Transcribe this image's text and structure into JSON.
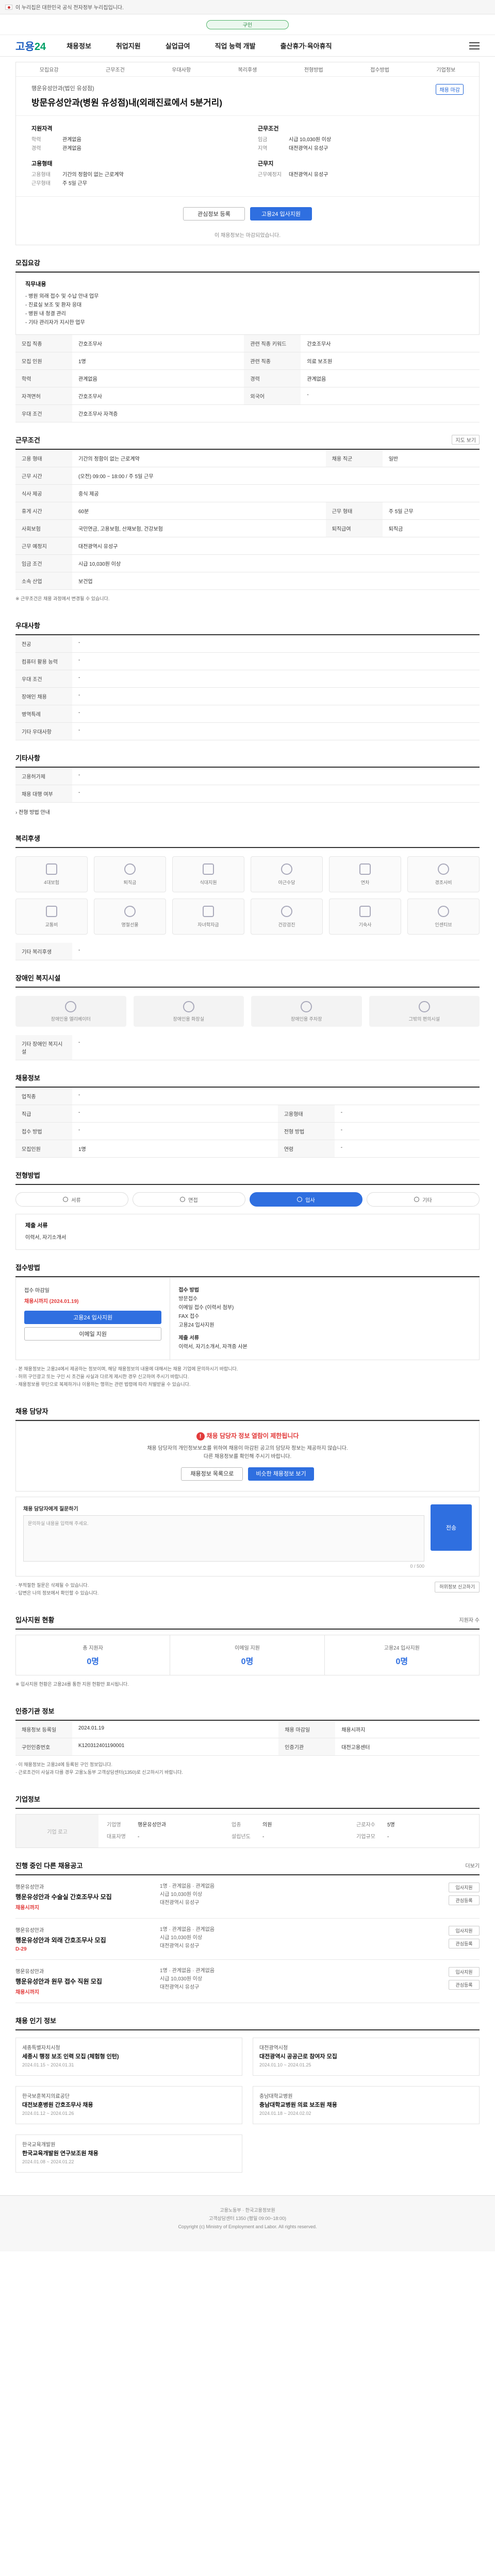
{
  "gov_banner": "이 누리집은 대한민국 공식 전자정부 누리집입니다.",
  "search": {
    "label": "구인"
  },
  "header": {
    "logo_main": "고용",
    "logo_sub": "24",
    "nav": [
      "채용정보",
      "취업지원",
      "실업급여",
      "직업 능력 개발",
      "출산휴가·육아휴직"
    ]
  },
  "title_tabs": [
    "모집요강",
    "근무조건",
    "우대사항",
    "복리후생",
    "전형방법",
    "접수방법",
    "기업정보"
  ],
  "posting": {
    "company": "행운유성안과(법인 유성점)",
    "title": "방문유성안과(병원 유성점)내(외래진료에서 5분거리)",
    "status": "채용 마감",
    "summary_left_title": "지원자격",
    "summary_left": [
      {
        "k": "학력",
        "v": "관계없음"
      },
      {
        "k": "경력",
        "v": "관계없음"
      }
    ],
    "summary_left2_title": "고용형태",
    "summary_left2": [
      {
        "k": "고용형태",
        "v": "기간의 정함이 없는 근로계약"
      },
      {
        "k": "근무형태",
        "v": "주 5일 근무"
      }
    ],
    "summary_right_title": "근무조건",
    "summary_right": [
      {
        "k": "임금",
        "v": "시급 10,030원 이상"
      },
      {
        "k": "지역",
        "v": "대전광역시 유성구"
      }
    ],
    "summary_right2_title": "근무지",
    "summary_right2": [
      {
        "k": "근무예정지",
        "v": "대전광역시 유성구"
      }
    ],
    "btn_scrap": "관심정보 등록",
    "btn_apply": "고용24 입사지원",
    "cta_note": "이 채용정보는 마감되었습니다."
  },
  "recruit": {
    "title": "모집요강",
    "job_desc_title": "직무내용",
    "job_desc": [
      "- 병원 외래 접수 및 수납 안내 업무",
      "- 진료실 보조 및 환자 응대",
      "- 병원 내 청결 관리",
      "- 기타 관리자가 지시한 업무"
    ],
    "rows": [
      {
        "th": "모집 직종",
        "td": "간호조무사",
        "th2": "관련 직종 키워드",
        "td2": "간호조무사"
      },
      {
        "th": "모집 인원",
        "td": "1명",
        "th2": "관련 직종",
        "td2": "의료 보조원"
      },
      {
        "th": "학력",
        "td": "관계없음",
        "th2": "경력",
        "td2": "관계없음"
      },
      {
        "th": "자격면허",
        "td": "간호조무사",
        "th2": "외국어",
        "td2": "-"
      },
      {
        "th": "우대 조건",
        "td": "간호조무사 자격증",
        "th2": "",
        "td2": ""
      }
    ]
  },
  "conditions": {
    "title": "근무조건",
    "rows": [
      {
        "th": "고용 형태",
        "td": "기간의 정함이 없는 근로계약",
        "th2": "채용 직군",
        "td2": "일반"
      },
      {
        "th": "근무 시간",
        "td": "(오전) 09:00 ~ 18:00 / 주 5일 근무",
        "th2": "",
        "td2": ""
      },
      {
        "th": "식사 제공",
        "td": "중식 제공",
        "th2": "",
        "td2": ""
      },
      {
        "th": "휴게 시간",
        "td": "60분",
        "th2": "근무 형태",
        "td2": "주 5일 근무"
      },
      {
        "th": "사회보험",
        "td": "국민연금, 고용보험, 산재보험, 건강보험",
        "th2": "퇴직급여",
        "td2": "퇴직금"
      },
      {
        "th": "근무 예정지",
        "td": "대전광역시 유성구",
        "th2": "",
        "td2": ""
      },
      {
        "th": "임금 조건",
        "td": "시급 10,030원 이상",
        "th2": "",
        "td2": ""
      },
      {
        "th": "소속 산업",
        "td": "보건업",
        "th2": "",
        "td2": ""
      }
    ],
    "map_btn": "지도 보기",
    "note": "※ 근무조건은 채용 과정에서 변경될 수 있습니다."
  },
  "pref": {
    "title": "우대사항",
    "rows": [
      {
        "th": "전공",
        "td": "-"
      },
      {
        "th": "컴퓨터 활용 능력",
        "td": "-"
      },
      {
        "th": "우대 조건",
        "td": "-"
      },
      {
        "th": "장애인 채용",
        "td": "-"
      },
      {
        "th": "병역특례",
        "td": "-"
      },
      {
        "th": "기타 우대사항",
        "td": "-"
      }
    ]
  },
  "etc": {
    "title": "기타사항",
    "rows": [
      {
        "th": "고용허가제",
        "td": "-"
      },
      {
        "th": "채용 대행 여부",
        "td": "-"
      }
    ],
    "link": "전형 방법 안내"
  },
  "benefits": {
    "title": "복리후생",
    "icons": [
      "4대보험",
      "퇴직금",
      "식대지원",
      "야근수당",
      "연차",
      "경조사비",
      "교통비",
      "명절선물",
      "자녀학자금",
      "건강검진",
      "기숙사",
      "인센티브"
    ],
    "other_label": "기타 복리후생"
  },
  "welfare": {
    "title": "장애인 복지시설",
    "items": [
      "장애인용 엘리베이터",
      "장애인용 화장실",
      "장애인용 주차장",
      "그밖의 편의시설"
    ],
    "other_label": "기타 장애인 복지시설"
  },
  "worker": {
    "title": "채용정보",
    "rows": [
      {
        "th": "업직종",
        "td": "-",
        "th2": "",
        "td2": ""
      },
      {
        "th": "직급",
        "td": "-",
        "th2": "고용형태",
        "td2": "-"
      },
      {
        "th": "접수 방법",
        "td": "-",
        "th2": "전형 방법",
        "td2": "-"
      },
      {
        "th": "모집인원",
        "td": "1명",
        "th2": "연령",
        "td2": "-"
      }
    ]
  },
  "process": {
    "title": "전형방법",
    "steps": [
      "서류",
      "면접",
      "입사",
      "기타"
    ],
    "active": 2,
    "sub_title": "제출 서류",
    "sub_text": "이력서, 자기소개서"
  },
  "apply": {
    "title": "접수방법",
    "period_label": "접수 마감일",
    "period": "채용시까지 (2024.01.19)",
    "btn_apply": "고용24 입사지원",
    "btn_email": "이메일 지원",
    "right_title": "접수 방법",
    "right_lines": [
      "방문접수",
      "이메일 접수 (이력서 첨부)",
      "FAX 접수",
      "고용24 입사지원"
    ],
    "right_title2": "제출 서류",
    "right_lines2": [
      "이력서, 자기소개서, 자격증 사본"
    ],
    "notices": [
      "· 본 채용정보는 고용24에서 제공하는 정보이며, 해당 채용정보의 내용에 대해서는 채용 기업에 문의하시기 바랍니다.",
      "· 허위 구인광고 또는 구인 시 조건을 사실과 다르게 제시한 경우 신고하여 주시기 바랍니다.",
      "· 채용정보를 무단으로 복제하거나 이용하는 행위는 관련 법령에 따라 처벌받을 수 있습니다."
    ]
  },
  "manager": {
    "title": "채용 담당자",
    "alert_title": "채용 담당자 정보 열람이 제한됩니다",
    "alert_lines": [
      "채용 담당자의 개인정보보호를 위하여 채용이 마감된 공고의 담당자 정보는 제공하지 않습니다.",
      "다른 채용정보를 확인해 주시기 바랍니다."
    ],
    "btn1": "채용정보 목록으로",
    "btn2": "비슷한 채용정보 보기",
    "qa_title": "채용 담당자에게 질문하기",
    "qa_placeholder": "문의하실 내용을 입력해 주세요.",
    "qa_count": "0 / 500",
    "qa_send": "전송",
    "qa_notes": [
      "· 부적절한 질문은 삭제될 수 있습니다.",
      "· 답변은 나의 정보에서 확인할 수 있습니다."
    ],
    "report_btn": "허위정보 신고하기"
  },
  "stats": {
    "title": "입사지원 현황",
    "right": "지원자 수",
    "items": [
      {
        "label": "총 지원자",
        "value": "0명"
      },
      {
        "label": "이메일 지원",
        "value": "0명"
      },
      {
        "label": "고용24 입사지원",
        "value": "0명"
      }
    ],
    "note": "※ 입사지원 현황은 고용24를 통한 지원 현황만 표시됩니다."
  },
  "regist": {
    "title": "인증기관 정보",
    "rows": [
      {
        "th": "채용정보 등록일",
        "td": "2024.01.19",
        "th2": "채용 마감일",
        "td2": "채용시까지"
      },
      {
        "th": "구인인증번호",
        "td": "K120312401190001",
        "th2": "인증기관",
        "td2": "대전고용센터"
      }
    ],
    "notes": [
      "· 이 채용정보는 고용24에 등록된 구인 정보입니다.",
      "· 근로조건이 사실과 다를 경우 고용노동부 고객상담센터(1350)로 신고하시기 바랍니다."
    ]
  },
  "company": {
    "title": "기업정보",
    "logo_text": "기업 로고",
    "fields": [
      {
        "k": "기업명",
        "v": "행운유성안과"
      },
      {
        "k": "업종",
        "v": "의원"
      },
      {
        "k": "근로자수",
        "v": "5명"
      },
      {
        "k": "대표자명",
        "v": "-"
      },
      {
        "k": "설립년도",
        "v": "-"
      },
      {
        "k": "기업규모",
        "v": "-"
      }
    ]
  },
  "same_company": {
    "title": "진행 중인 다른 채용공고",
    "right": "더보기",
    "jobs": [
      {
        "co": "행운유성안과",
        "tt": "행운유성안과 수술실 간호조무사 모집",
        "meta1": "1명 · 관계없음 · 관계없음",
        "meta2": "시급 10,030원 이상",
        "meta3": "대전광역시 유성구",
        "dday": "채용시까지",
        "b1": "입사지원",
        "b2": "관심등록"
      },
      {
        "co": "행운유성안과",
        "tt": "행운유성안과 외래 간호조무사 모집",
        "meta1": "1명 · 관계없음 · 관계없음",
        "meta2": "시급 10,030원 이상",
        "meta3": "대전광역시 유성구",
        "dday": "D-29",
        "b1": "입사지원",
        "b2": "관심등록"
      },
      {
        "co": "행운유성안과",
        "tt": "행운유성안과 원무 접수 직원 모집",
        "meta1": "1명 · 관계없음 · 관계없음",
        "meta2": "시급 10,030원 이상",
        "meta3": "대전광역시 유성구",
        "dday": "채용시까지",
        "b1": "입사지원",
        "b2": "관심등록"
      }
    ]
  },
  "hot": {
    "title": "채용 인기 정보",
    "items": [
      {
        "co": "세종특별자치시청",
        "tt": "세종시 행정 보조 인력 모집 (체험형 인턴)",
        "dt": "2024.01.15 ~ 2024.01.31"
      },
      {
        "co": "대전광역시청",
        "tt": "대전광역시 공공근로 참여자 모집",
        "dt": "2024.01.10 ~ 2024.01.25"
      },
      {
        "co": "한국보훈복지의료공단",
        "tt": "대전보훈병원 간호조무사 채용",
        "dt": "2024.01.12 ~ 2024.01.26"
      },
      {
        "co": "충남대학교병원",
        "tt": "충남대학교병원 의료 보조원 채용",
        "dt": "2024.01.18 ~ 2024.02.02"
      },
      {
        "co": "한국교육개발원",
        "tt": "한국교육개발원 연구보조원 채용",
        "dt": "2024.01.08 ~ 2024.01.22"
      }
    ]
  },
  "footer": {
    "lines": [
      "고용노동부 · 한국고용정보원",
      "고객상담센터 1350 (평일 09:00~18:00)",
      "Copyright (c) Ministry of Employment and Labor. All rights reserved."
    ]
  },
  "colors": {
    "primary": "#2f6fe0",
    "danger": "#e23b3b",
    "brand_green": "#00a066"
  }
}
